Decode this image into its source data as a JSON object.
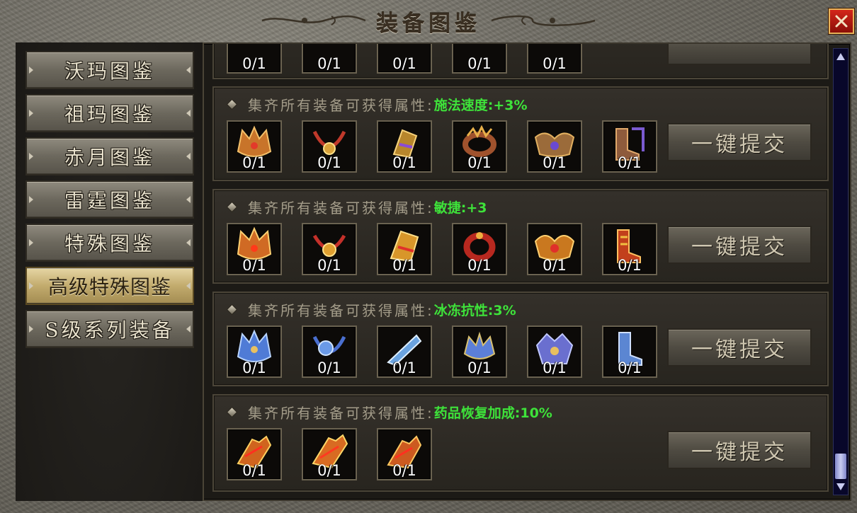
{
  "window": {
    "title": "装备图鉴",
    "close_label": "×"
  },
  "sidebar": {
    "items": [
      {
        "label": "沃玛图鉴",
        "active": false
      },
      {
        "label": "祖玛图鉴",
        "active": false
      },
      {
        "label": "赤月图鉴",
        "active": false
      },
      {
        "label": "雷霆图鉴",
        "active": false
      },
      {
        "label": "特殊图鉴",
        "active": false
      },
      {
        "label": "高级特殊图鉴",
        "active": true
      },
      {
        "label": "S级系列装备",
        "active": false
      }
    ]
  },
  "content": {
    "partial_top": {
      "slots": [
        {
          "count": "0/1"
        },
        {
          "count": "0/1"
        },
        {
          "count": "0/1"
        },
        {
          "count": "0/1"
        },
        {
          "count": "0/1"
        }
      ]
    },
    "sets": [
      {
        "prefix": "集齐所有装备可获得属性:",
        "bonus": "施法速度:+3%",
        "submit_label": "一键提交",
        "slots": [
          {
            "count": "0/1",
            "icon": "helmet-icon",
            "color": "#c8742a"
          },
          {
            "count": "0/1",
            "icon": "necklace-icon",
            "color": "#c0392b"
          },
          {
            "count": "0/1",
            "icon": "bracelet-icon",
            "color": "#b7862c"
          },
          {
            "count": "0/1",
            "icon": "ring-icon",
            "color": "#a0522d"
          },
          {
            "count": "0/1",
            "icon": "belt-icon",
            "color": "#9b6b3a"
          },
          {
            "count": "0/1",
            "icon": "boots-icon",
            "color": "#8e5b3c"
          }
        ]
      },
      {
        "prefix": "集齐所有装备可获得属性:",
        "bonus": "敏捷:+3",
        "submit_label": "一键提交",
        "slots": [
          {
            "count": "0/1",
            "icon": "helmet-icon",
            "color": "#d06a24"
          },
          {
            "count": "0/1",
            "icon": "necklace-icon",
            "color": "#c4302a"
          },
          {
            "count": "0/1",
            "icon": "bracelet-icon",
            "color": "#d8962a"
          },
          {
            "count": "0/1",
            "icon": "ring-icon",
            "color": "#b8281f"
          },
          {
            "count": "0/1",
            "icon": "belt-icon",
            "color": "#c9781f"
          },
          {
            "count": "0/1",
            "icon": "boots-icon",
            "color": "#c2401c"
          }
        ]
      },
      {
        "prefix": "集齐所有装备可获得属性:",
        "bonus": "冰冻抗性:3%",
        "submit_label": "一键提交",
        "slots": [
          {
            "count": "0/1",
            "icon": "helmet-icon",
            "color": "#4f7bd6"
          },
          {
            "count": "0/1",
            "icon": "necklace-icon",
            "color": "#4a6fd0"
          },
          {
            "count": "0/1",
            "icon": "bracelet-icon",
            "color": "#6aa3e0"
          },
          {
            "count": "0/1",
            "icon": "ring-icon",
            "color": "#5c7fd8"
          },
          {
            "count": "0/1",
            "icon": "belt-icon",
            "color": "#6a6fcf"
          },
          {
            "count": "0/1",
            "icon": "boots-icon",
            "color": "#5b86d2"
          }
        ]
      },
      {
        "prefix": "集齐所有装备可获得属性:",
        "bonus": "药品恢复加成:10%",
        "submit_label": "一键提交",
        "slots": [
          {
            "count": "0/1",
            "icon": "gauntlet-icon",
            "color": "#d0641e"
          },
          {
            "count": "0/1",
            "icon": "gauntlet-icon",
            "color": "#d86b22"
          },
          {
            "count": "0/1",
            "icon": "gauntlet-icon",
            "color": "#cc5a20"
          }
        ]
      }
    ]
  },
  "colors": {
    "bonus_text": "#3ee23a",
    "active_tab": "#c2ab6d",
    "close_button": "#c0201a",
    "scroll_thumb": "#b4b9ea"
  }
}
